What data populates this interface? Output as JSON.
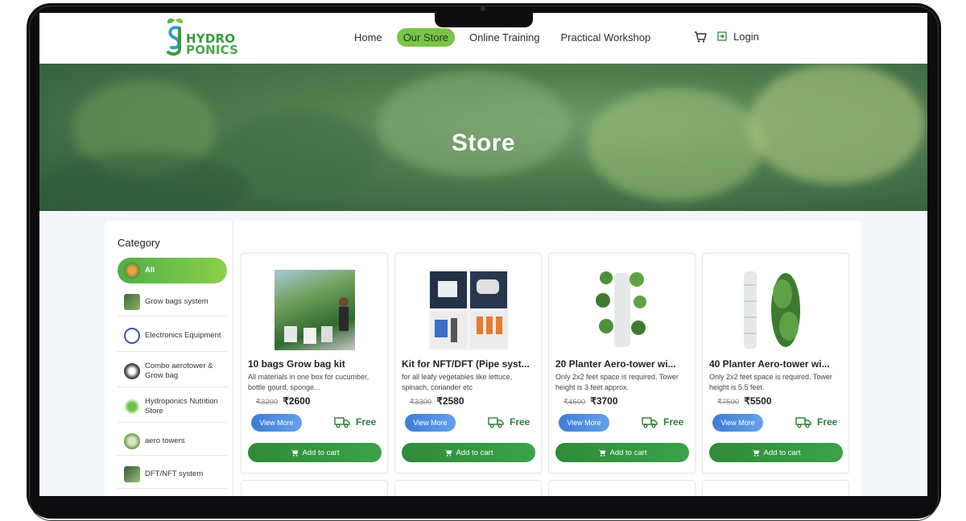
{
  "brand": {
    "line1": "HYDRO",
    "line2": "PONICS",
    "color": "#3a9a3a"
  },
  "nav": {
    "items": [
      {
        "label": "Home",
        "active": false
      },
      {
        "label": "Our Store",
        "active": true
      },
      {
        "label": "Online Training",
        "active": false
      },
      {
        "label": "Practical Workshop",
        "active": false
      }
    ],
    "cart_icon": "cart-icon",
    "login_label": "Login",
    "accent": "#7cc34a"
  },
  "hero": {
    "title": "Store"
  },
  "sidebar": {
    "title": "Category",
    "items": [
      {
        "label": "All",
        "icon": "seedling-icon"
      },
      {
        "label": "Grow bags system",
        "icon": "grow-bag-thumb"
      },
      {
        "label": "Electronics Equipment",
        "icon": "electronics-icon"
      },
      {
        "label": "Combo aerotower & Grow bag",
        "icon": "combo-icon"
      },
      {
        "label": "Hydroponics Nutrition Store",
        "icon": "leaf-icon"
      },
      {
        "label": "aero towers",
        "icon": "aero-tower-thumb"
      },
      {
        "label": "DFT/NFT system",
        "icon": "nft-thumb"
      }
    ]
  },
  "products": [
    {
      "title": "10 bags Grow bag kit",
      "desc": "All materials in one box for cucumber, bottle gourd, sponge...",
      "mrp": "₹3200",
      "price": "₹2600",
      "view_label": "View More",
      "shipping": "Free",
      "cart_label": "Add to cart"
    },
    {
      "title": "Kit for NFT/DFT (Pipe syst...",
      "desc": "for all leafy vegetables like lettuce, spinach, coriander etc",
      "mrp": "₹3300",
      "price": "₹2580",
      "view_label": "View More",
      "shipping": "Free",
      "cart_label": "Add to cart"
    },
    {
      "title": "20 Planter Aero-tower wi...",
      "desc": "Only 2x2 feet space is required. Tower height is 3 feet approx.",
      "mrp": "₹4500",
      "price": "₹3700",
      "view_label": "View More",
      "shipping": "Free",
      "cart_label": "Add to cart"
    },
    {
      "title": "40 Planter Aero-tower wi...",
      "desc": "Only 2x2 feet space is required. Tower height is 5.5 feet.",
      "mrp": "₹7500",
      "price": "₹5500",
      "view_label": "View More",
      "shipping": "Free",
      "cart_label": "Add to cart"
    }
  ]
}
